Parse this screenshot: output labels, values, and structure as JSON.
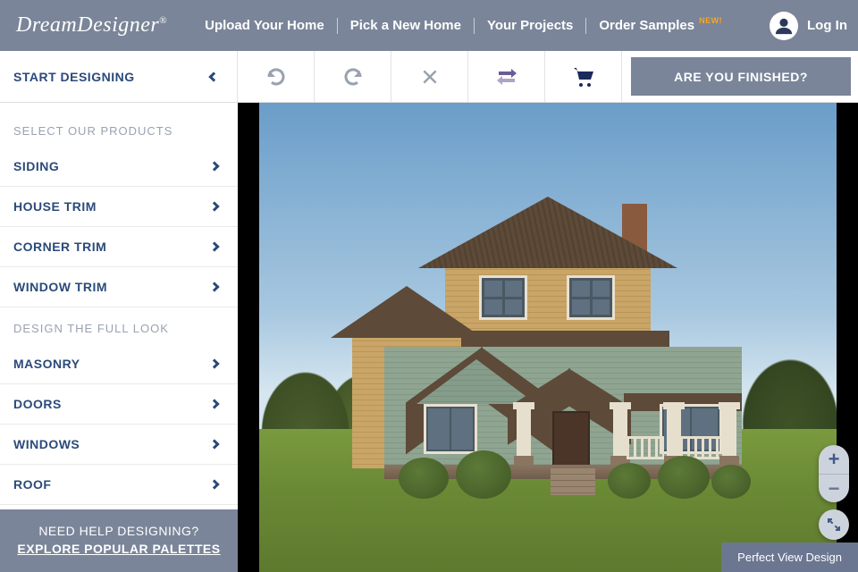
{
  "brand": {
    "part1": "Dream",
    "part2": "Designer",
    "reg": "®"
  },
  "nav": {
    "upload": "Upload Your Home",
    "pick": "Pick a New Home",
    "projects": "Your Projects",
    "samples": "Order Samples",
    "new_badge": "NEW!",
    "login": "Log In"
  },
  "toolbar": {
    "start": "START DESIGNING",
    "finish": "ARE YOU FINISHED?"
  },
  "sidebar": {
    "section1_header": "SELECT OUR PRODUCTS",
    "section1": [
      "SIDING",
      "HOUSE TRIM",
      "CORNER TRIM",
      "WINDOW TRIM"
    ],
    "section2_header": "DESIGN THE FULL LOOK",
    "section2": [
      "MASONRY",
      "DOORS",
      "WINDOWS",
      "ROOF"
    ],
    "help_q": "NEED HELP DESIGNING?",
    "help_link": "EXPLORE POPULAR PALETTES"
  },
  "canvas": {
    "perfect_view": "Perfect View Design",
    "zoom_in": "+",
    "zoom_out": "−"
  },
  "colors": {
    "brand_blue": "#2b4a7a",
    "header_grey": "#7a8599",
    "accent_orange": "#f5a623"
  }
}
